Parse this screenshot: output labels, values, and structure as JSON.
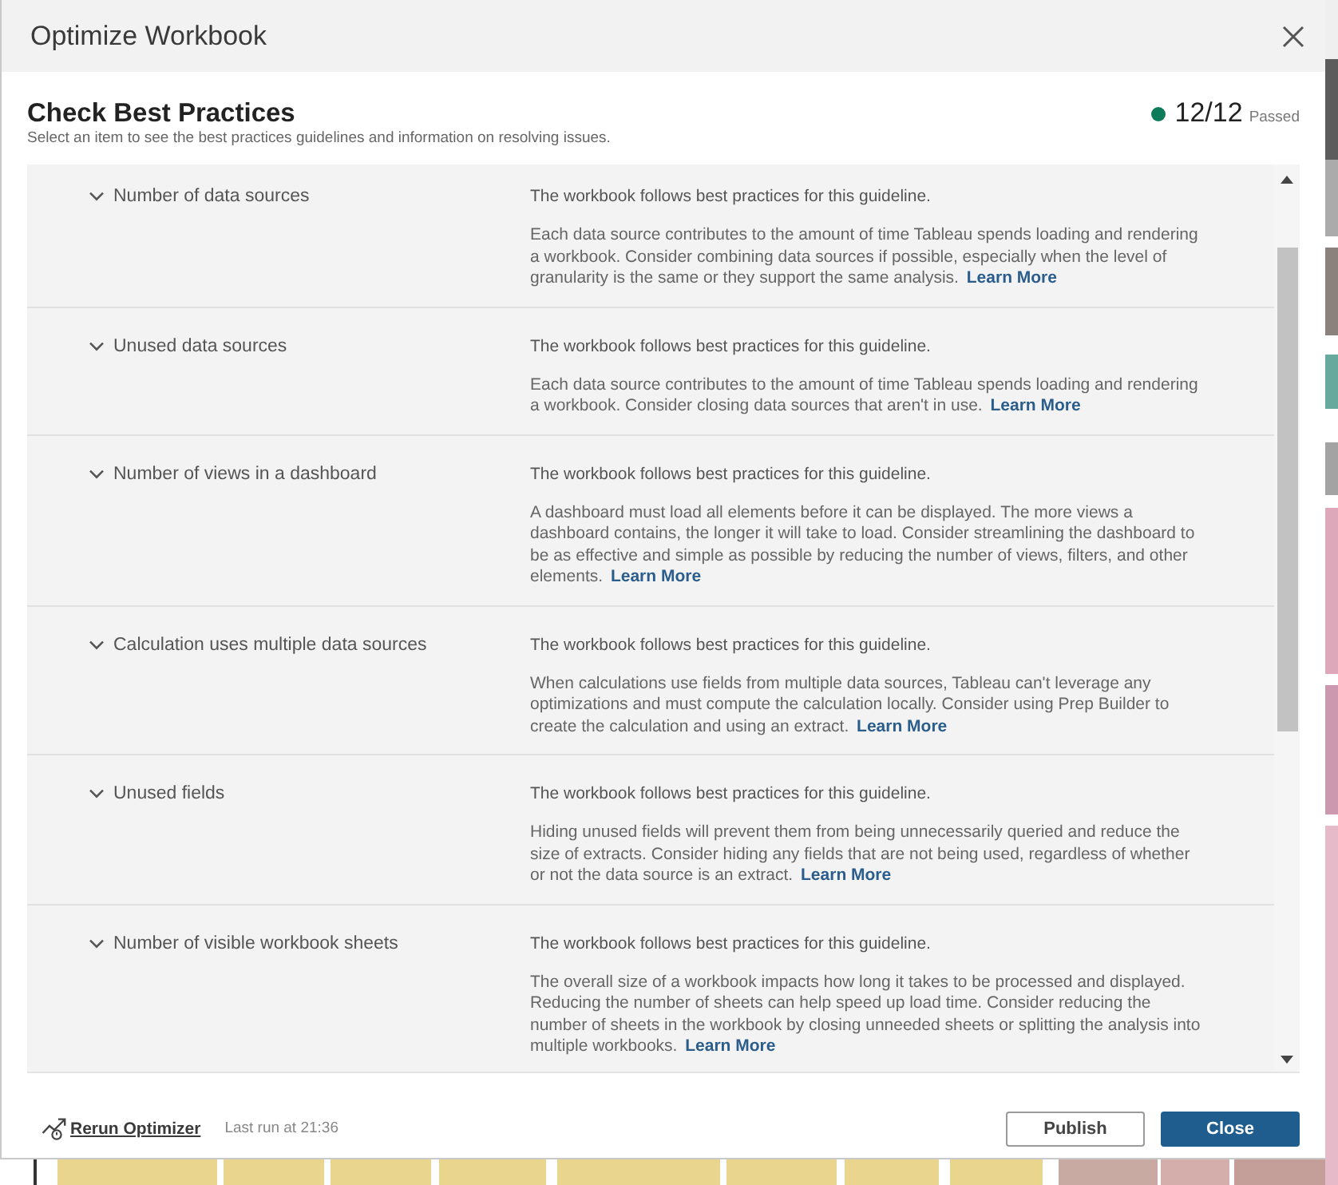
{
  "window": {
    "title": "Optimize Workbook"
  },
  "header": {
    "title": "Check Best Practices",
    "subtitle": "Select an item to see the best practices guidelines and information on resolving issues.",
    "score": "12/12",
    "score_label": "Passed"
  },
  "guidelines": [
    {
      "title": "Number of data sources",
      "expanded": true,
      "status": "The workbook follows best practices for this guideline.",
      "description": "Each data source contributes to the amount of time Tableau spends loading and rendering a workbook. Consider combining data sources if possible, especially when the level of granularity is the same or they support the same analysis.",
      "link": "Learn More"
    },
    {
      "title": "Unused data sources",
      "expanded": true,
      "status": "The workbook follows best practices for this guideline.",
      "description": "Each data source contributes to the amount of time Tableau spends loading and rendering a workbook. Consider closing data sources that aren't in use.",
      "link": "Learn More"
    },
    {
      "title": "Number of views in a dashboard",
      "expanded": true,
      "status": "The workbook follows best practices for this guideline.",
      "description": "A dashboard must load all elements before it can be displayed. The more views a dashboard contains, the longer it will take to load. Consider streamlining the dashboard to be as effective and simple as possible by reducing the number of views, filters, and other elements.",
      "link": "Learn More"
    },
    {
      "title": "Calculation uses multiple data sources",
      "expanded": true,
      "status": "The workbook follows best practices for this guideline.",
      "description": "When calculations use fields from multiple data sources, Tableau can't leverage any optimizations and must compute the calculation locally. Consider using Prep Builder to create the calculation and using an extract.",
      "link": "Learn More"
    },
    {
      "title": "Unused fields",
      "expanded": true,
      "status": "The workbook follows best practices for this guideline.",
      "description": "Hiding unused fields will prevent them from being unnecessarily queried and reduce the size of extracts. Consider hiding any fields that are not being used, regardless of whether or not the data source is an extract.",
      "link": "Learn More"
    },
    {
      "title": "Number of visible workbook sheets",
      "expanded": true,
      "status": "The workbook follows best practices for this guideline.",
      "description": "The overall size of a workbook impacts how long it takes to be processed and displayed. Reducing the number of sheets can help speed up load time. Consider reducing the number of sheets in the workbook by closing unneeded sheets or splitting the analysis into multiple workbooks.",
      "link": "Learn More"
    }
  ],
  "footer": {
    "rerun": "Rerun Optimizer",
    "last_run": "Last run at 21:36",
    "buttons": [
      {
        "label": "Publish",
        "kind": "secondary"
      },
      {
        "label": "Close",
        "kind": "primary"
      }
    ]
  }
}
